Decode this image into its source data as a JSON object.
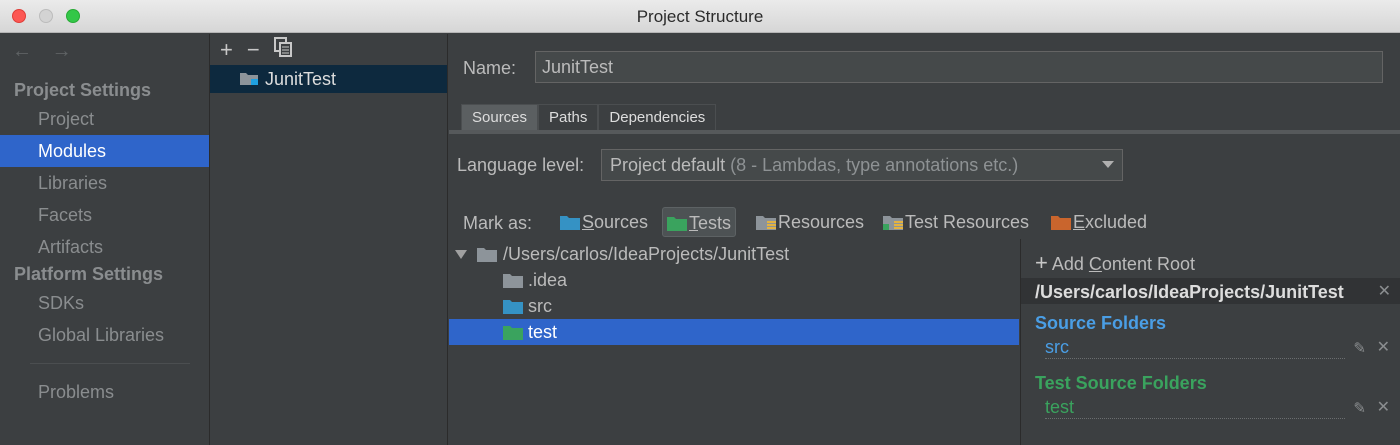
{
  "window": {
    "title": "Project Structure"
  },
  "colors": {
    "selection": "#2f65ca",
    "source_folder": "#4a9ee5",
    "test_folder": "#3aa35e",
    "resources": "#bbbbbb",
    "excluded": "#c9652d",
    "folder_gray": "#8d949a",
    "sources_teal": "#3592c4"
  },
  "sidebar": {
    "nav_back": "←",
    "nav_forward": "→",
    "project_settings_header": "Project Settings",
    "platform_settings_header": "Platform Settings",
    "items": [
      {
        "label": "Project",
        "selected": false
      },
      {
        "label": "Modules",
        "selected": true
      },
      {
        "label": "Libraries",
        "selected": false
      },
      {
        "label": "Facets",
        "selected": false
      },
      {
        "label": "Artifacts",
        "selected": false
      }
    ],
    "platform_items": [
      {
        "label": "SDKs"
      },
      {
        "label": "Global Libraries"
      }
    ],
    "problems_label": "Problems"
  },
  "modules": {
    "toolbar": {
      "add": "+",
      "remove": "−",
      "copy_icon": "copy-icon"
    },
    "list": [
      {
        "name": "JunitTest",
        "selected": true
      }
    ]
  },
  "content": {
    "name_label": "Name:",
    "name_value": "JunitTest",
    "tabs": [
      {
        "label": "Sources",
        "active": true
      },
      {
        "label": "Paths",
        "active": false
      },
      {
        "label": "Dependencies",
        "active": false
      }
    ],
    "language_level_label": "Language level:",
    "language_level_value": "Project default",
    "language_level_detail": "(8 - Lambdas, type annotations etc.)",
    "mark_as_label": "Mark as:",
    "mark_as": [
      {
        "key": "sources",
        "label": "Sources",
        "underline": "S",
        "rest": "ources",
        "active": false
      },
      {
        "key": "tests",
        "label": "Tests",
        "underline": "T",
        "rest": "ests",
        "active": true
      },
      {
        "key": "resources",
        "label": "Resources",
        "active": false
      },
      {
        "key": "test_resources",
        "label": "Test Resources",
        "active": false
      },
      {
        "key": "excluded",
        "label": "Excluded",
        "underline": "E",
        "rest": "xcluded",
        "active": false
      }
    ]
  },
  "tree": {
    "root": "/Users/carlos/IdeaProjects/JunitTest",
    "children": [
      {
        "name": ".idea",
        "kind": "plain",
        "selected": false
      },
      {
        "name": "src",
        "kind": "source",
        "selected": false
      },
      {
        "name": "test",
        "kind": "test",
        "selected": true
      }
    ]
  },
  "roots_panel": {
    "add_content_root": "Add Content Root",
    "add_underline": "C",
    "add_prefix": "Add ",
    "add_rest": "ontent Root",
    "root_path": "/Users/carlos/IdeaProjects/JunitTest",
    "source_folders_header": "Source Folders",
    "source_folders": [
      "src"
    ],
    "test_source_folders_header": "Test Source Folders",
    "test_source_folders": [
      "test"
    ]
  }
}
